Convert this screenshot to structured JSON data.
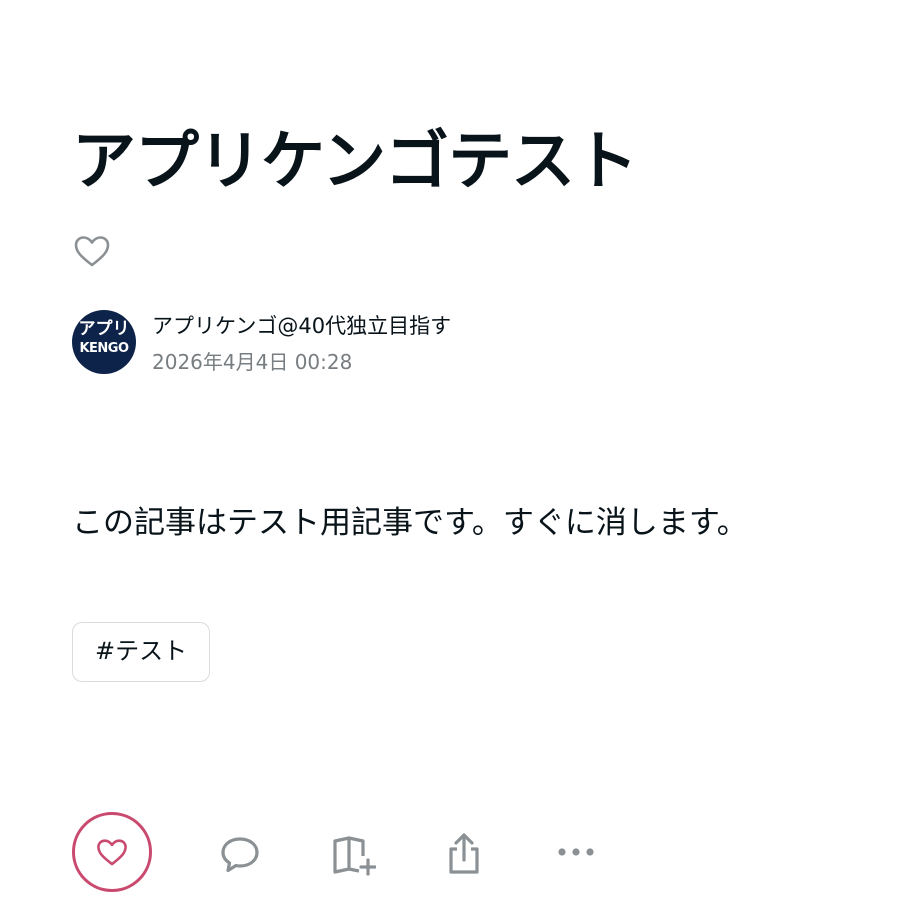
{
  "article": {
    "title": "アプリケンゴテスト",
    "body": "この記事はテスト用記事です。すぐに消します。"
  },
  "author": {
    "avatar_line1": "アプリ",
    "avatar_line2": "KENGO",
    "name": "アプリケンゴ@40代独立目指す",
    "date": "2026年4月4日 00:28"
  },
  "tags": [
    {
      "label": "#テスト"
    }
  ],
  "icons": {
    "top_like": "heart-outline-icon",
    "like": "heart-icon",
    "comment": "comment-bubble-icon",
    "magazine": "book-add-icon",
    "share": "share-icon",
    "more": "more-dots-icon"
  },
  "colors": {
    "accent_like": "#c94a6e",
    "icon_gray": "#8a9093",
    "avatar_bg": "#0e2349",
    "text": "#08131a",
    "muted_text": "#777d80"
  }
}
